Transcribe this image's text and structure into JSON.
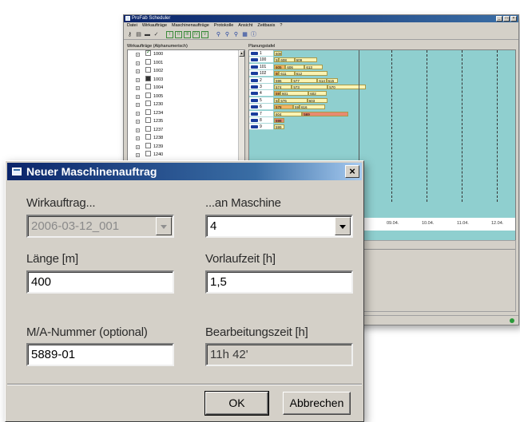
{
  "main_window": {
    "title": "ProFab Scheduler",
    "window_buttons": [
      "_",
      "□",
      "×"
    ],
    "menu": [
      "Datei",
      "Wirkaufträge",
      "Maschinenaufträge",
      "Protokolle",
      "Ansicht",
      "Zeitbasis",
      "?"
    ],
    "left_pane_label": "Wirkaufträge (Alphanumerisch)",
    "tree_items": [
      {
        "label": "1000",
        "state": "checked"
      },
      {
        "label": "1001",
        "state": "empty"
      },
      {
        "label": "1002",
        "state": "empty"
      },
      {
        "label": "1003",
        "state": "filled"
      },
      {
        "label": "1004",
        "state": "empty"
      },
      {
        "label": "1005",
        "state": "empty"
      },
      {
        "label": "1230",
        "state": "empty"
      },
      {
        "label": "1234",
        "state": "empty"
      },
      {
        "label": "1235",
        "state": "empty"
      },
      {
        "label": "1237",
        "state": "empty"
      },
      {
        "label": "1238",
        "state": "empty"
      },
      {
        "label": "1239",
        "state": "empty"
      },
      {
        "label": "1240",
        "state": "empty"
      }
    ],
    "right_pane_label": "Planungstafel",
    "gantt_rows": [
      {
        "machine": "1",
        "bars": [
          {
            "label": "608",
            "start": 0,
            "len": 6,
            "color": "yellow"
          }
        ]
      },
      {
        "machine": "100",
        "bars": [
          {
            "label": "58",
            "start": 0,
            "len": 4,
            "color": "yellow"
          },
          {
            "label": "608",
            "start": 4,
            "len": 12,
            "color": "yellow"
          },
          {
            "label": "609",
            "start": 16,
            "len": 18,
            "color": "yellow"
          }
        ]
      },
      {
        "machine": "101",
        "bars": [
          {
            "label": "605",
            "start": 0,
            "len": 9,
            "color": "orange"
          },
          {
            "label": "606",
            "start": 9,
            "len": 15,
            "color": "yellow"
          },
          {
            "label": "613",
            "start": 24,
            "len": 14,
            "color": "yellow"
          }
        ]
      },
      {
        "machine": "102",
        "bars": [
          {
            "label": "60",
            "start": 0,
            "len": 4,
            "color": "orange"
          },
          {
            "label": "611",
            "start": 4,
            "len": 12,
            "color": "yellow"
          },
          {
            "label": "612",
            "start": 16,
            "len": 26,
            "color": "yellow"
          }
        ]
      },
      {
        "machine": "2",
        "bars": [
          {
            "label": "596",
            "start": 0,
            "len": 14,
            "color": "yellow"
          },
          {
            "label": "577",
            "start": 14,
            "len": 20,
            "color": "yellow"
          },
          {
            "label": "614",
            "start": 34,
            "len": 7,
            "color": "yellow"
          },
          {
            "label": "615",
            "start": 41,
            "len": 9,
            "color": "yellow"
          }
        ]
      },
      {
        "machine": "3",
        "bars": [
          {
            "label": "574",
            "start": 0,
            "len": 14,
            "color": "yellow"
          },
          {
            "label": "573",
            "start": 14,
            "len": 28,
            "color": "yellow"
          },
          {
            "label": "570",
            "start": 42,
            "len": 30,
            "color": "yellow"
          }
        ]
      },
      {
        "machine": "4",
        "bars": [
          {
            "label": "598",
            "start": 0,
            "len": 5,
            "color": "orange"
          },
          {
            "label": "601",
            "start": 5,
            "len": 22,
            "color": "yellow"
          },
          {
            "label": "602",
            "start": 27,
            "len": 14,
            "color": "yellow"
          }
        ]
      },
      {
        "machine": "5",
        "bars": [
          {
            "label": "58",
            "start": 0,
            "len": 4,
            "color": "yellow"
          },
          {
            "label": "576",
            "start": 4,
            "len": 22,
            "color": "yellow"
          },
          {
            "label": "603",
            "start": 26,
            "len": 16,
            "color": "yellow"
          }
        ]
      },
      {
        "machine": "6",
        "bars": [
          {
            "label": "578",
            "start": 0,
            "len": 15,
            "color": "orange"
          },
          {
            "label": "595",
            "start": 15,
            "len": 5,
            "color": "yellow"
          },
          {
            "label": "616",
            "start": 20,
            "len": 20,
            "color": "yellow"
          }
        ]
      },
      {
        "machine": "7",
        "bars": [
          {
            "label": "604",
            "start": 0,
            "len": 22,
            "color": "yellow"
          },
          {
            "label": "569",
            "start": 22,
            "len": 36,
            "color": "red"
          }
        ]
      },
      {
        "machine": "8",
        "bars": [
          {
            "label": "598",
            "start": 0,
            "len": 8,
            "color": "red"
          }
        ]
      },
      {
        "machine": "9",
        "bars": [
          {
            "label": "599",
            "start": 0,
            "len": 8,
            "color": "yellow"
          }
        ]
      }
    ],
    "date_labels": [
      "09.04.",
      "10.04.",
      "11.04.",
      "12.04."
    ]
  },
  "dialog": {
    "title": "Neuer Maschinenauftrag",
    "close_label": "×",
    "wirkauftrag": {
      "label": "Wirkauftrag...",
      "value": "2006-03-12_001"
    },
    "maschine": {
      "label": "...an Maschine",
      "value": "4"
    },
    "laenge": {
      "label": "Länge [m]",
      "value": "400"
    },
    "vorlaufzeit": {
      "label": "Vorlaufzeit [h]",
      "value": "1,5"
    },
    "ma_nummer": {
      "label": "M/A-Nummer (optional)",
      "value": "5889-01"
    },
    "bearbeitungszeit": {
      "label": "Bearbeitungszeit [h]",
      "value": "11h 42'"
    },
    "ok_label": "OK",
    "cancel_label": "Abbrechen"
  }
}
